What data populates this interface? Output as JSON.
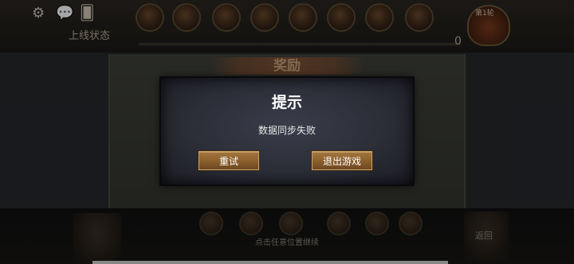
{
  "hud_top": {
    "status_label": "上线状态",
    "round_label": "第1轮",
    "score_text": "0"
  },
  "reward": {
    "title": "奖励"
  },
  "dialog": {
    "title": "提示",
    "message": "数据同步失败",
    "retry_label": "重试",
    "exit_label": "退出游戏"
  },
  "hud_bottom": {
    "hint": "点击任意位置继续",
    "back_label": "返回"
  },
  "icons": {
    "settings": "gear-icon",
    "chat": "chat-bubble-icon",
    "cards": "cards-icon"
  },
  "colors": {
    "button_gold": "#8a5e2c",
    "dialog_bg": "#2b2d37",
    "title_text": "#ffffff"
  }
}
